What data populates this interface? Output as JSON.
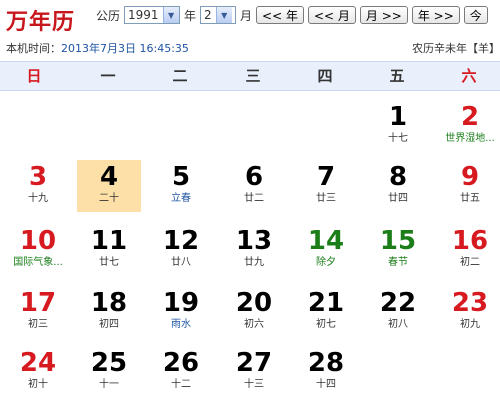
{
  "header": {
    "logo": "万年历",
    "gongli_label": "公历",
    "year_value": "1991",
    "year_label": "年",
    "month_value": "2",
    "month_label": "月",
    "buttons": [
      "<< 年",
      "<< 月",
      "月 >>",
      "年 >>",
      "今"
    ]
  },
  "status": {
    "local_time_label": "本机时间：",
    "local_time_value": "2013年7月3日 16:45:35",
    "lunar_text": "农历辛未年【羊】"
  },
  "weekdays": [
    "日",
    "一",
    "二",
    "三",
    "四",
    "五",
    "六"
  ],
  "weeks": [
    [
      {
        "d": "",
        "s": ""
      },
      {
        "d": "",
        "s": ""
      },
      {
        "d": "",
        "s": ""
      },
      {
        "d": "",
        "s": ""
      },
      {
        "d": "",
        "s": ""
      },
      {
        "d": "1",
        "s": "十七"
      },
      {
        "d": "2",
        "s": "世界湿地..."
      }
    ],
    [
      {
        "d": "3",
        "s": "十九"
      },
      {
        "d": "4",
        "s": "二十"
      },
      {
        "d": "5",
        "s": "立春"
      },
      {
        "d": "6",
        "s": "廿二"
      },
      {
        "d": "7",
        "s": "廿三"
      },
      {
        "d": "8",
        "s": "廿四"
      },
      {
        "d": "9",
        "s": "廿五"
      }
    ],
    [
      {
        "d": "10",
        "s": "国际气象..."
      },
      {
        "d": "11",
        "s": "廿七"
      },
      {
        "d": "12",
        "s": "廿八"
      },
      {
        "d": "13",
        "s": "廿九"
      },
      {
        "d": "14",
        "s": "除夕"
      },
      {
        "d": "15",
        "s": "春节"
      },
      {
        "d": "16",
        "s": "初二"
      }
    ],
    [
      {
        "d": "17",
        "s": "初三"
      },
      {
        "d": "18",
        "s": "初四"
      },
      {
        "d": "19",
        "s": "雨水"
      },
      {
        "d": "20",
        "s": "初六"
      },
      {
        "d": "21",
        "s": "初七"
      },
      {
        "d": "22",
        "s": "初八"
      },
      {
        "d": "23",
        "s": "初九"
      }
    ],
    [
      {
        "d": "24",
        "s": "初十"
      },
      {
        "d": "25",
        "s": "十一"
      },
      {
        "d": "26",
        "s": "十二"
      },
      {
        "d": "27",
        "s": "十三"
      },
      {
        "d": "28",
        "s": "十四"
      },
      {
        "d": "",
        "s": ""
      },
      {
        "d": "",
        "s": ""
      }
    ]
  ],
  "colors": {
    "red": "#d71920",
    "green": "#1b7e19",
    "blue": "#1f55a3",
    "today_bg": "#fce0a8",
    "header_bg": "#e9f0fb"
  }
}
